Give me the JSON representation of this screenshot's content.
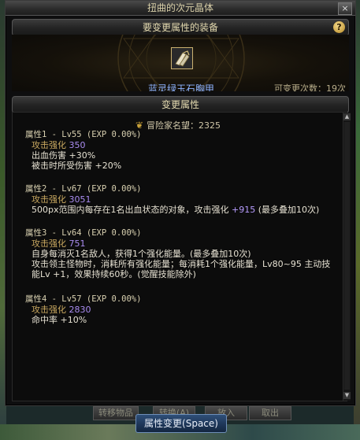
{
  "window": {
    "title": "扭曲的次元晶体",
    "close_label": "×"
  },
  "equip_section": {
    "header": "要变更属性的装备",
    "help_label": "?",
    "item_name": "蓝灵绿玉石胸甲",
    "change_count_label": "可变更次数：19次"
  },
  "attr_section": {
    "header": "变更属性",
    "fame_label": "冒险家名望：2325"
  },
  "attributes": [
    {
      "title": "属性1 - Lv55 (EXP 0.00%)",
      "sub_label": "攻击强化",
      "sub_value": "350",
      "lines": [
        "出血伤害 +30%",
        "被击时所受伤害 +20%"
      ]
    },
    {
      "title": "属性2 - Lv67 (EXP 0.00%)",
      "sub_label": "攻击强化",
      "sub_value": "3051",
      "line_pre": "500px范围内每存在1名出血状态的对象，攻击强化 ",
      "line_num": "+915",
      "line_post": " (最多叠加10次)"
    },
    {
      "title": "属性3 - Lv64 (EXP 0.00%)",
      "sub_label": "攻击强化",
      "sub_value": "751",
      "lines": [
        "自身每消灭1名敌人，获得1个强化能量。(最多叠加10次)",
        "攻击领主怪物时，消耗所有强化能量；每消耗1个强化能量，Lv80~95 主动技",
        "能Lv +1，效果持续60秒。(觉醒技能除外)"
      ]
    },
    {
      "title": "属性4 - Lv57 (EXP 0.00%)",
      "sub_label": "攻击强化",
      "sub_value": "2830",
      "lines": [
        "命中率 +10%"
      ]
    }
  ],
  "bottom_bar": {
    "hidden_buttons": [
      "转移物品",
      "转换(A)",
      "放入",
      "取出"
    ],
    "main_button": "属性变更(Space)"
  },
  "icons": {
    "fame": "laurel-icon",
    "item": "armor-icon",
    "help": "question-icon",
    "close": "close-icon"
  },
  "colors": {
    "item_name": "#8fb4ff",
    "attr_value": "#a98cf0",
    "header_text": "#e4dab0"
  }
}
